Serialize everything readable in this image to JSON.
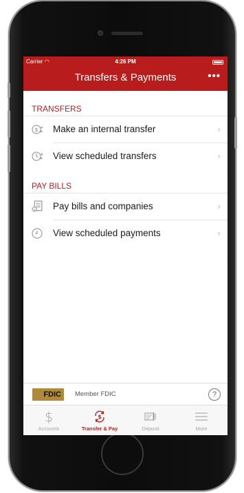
{
  "status_bar": {
    "carrier": "Carrier",
    "time": "4:26 PM"
  },
  "header": {
    "title": "Transfers & Payments",
    "more": "•••"
  },
  "transfers": {
    "heading": "TRANSFERS",
    "items": [
      {
        "label": "Make an internal transfer",
        "icon": "dollar-transfer-icon"
      },
      {
        "label": "View scheduled transfers",
        "icon": "clock-transfer-icon"
      }
    ]
  },
  "pay_bills": {
    "heading": "PAY BILLS",
    "items": [
      {
        "label": "Pay bills and companies",
        "icon": "bill-icon"
      },
      {
        "label": "View scheduled payments",
        "icon": "clock-icon"
      }
    ]
  },
  "chevron": "›",
  "fdic": {
    "logo": "FDIC",
    "text": "Member FDIC",
    "help": "?"
  },
  "tabs": [
    {
      "label": "Accounts",
      "icon": "dollar-icon",
      "active": false
    },
    {
      "label": "Transfer & Pay",
      "icon": "transfer-pay-icon",
      "active": true
    },
    {
      "label": "Deposit",
      "icon": "deposit-icon",
      "active": false
    },
    {
      "label": "More",
      "icon": "menu-icon",
      "active": false
    }
  ],
  "colors": {
    "brand": "#b91c1c",
    "inactive": "#9b9b9b"
  }
}
